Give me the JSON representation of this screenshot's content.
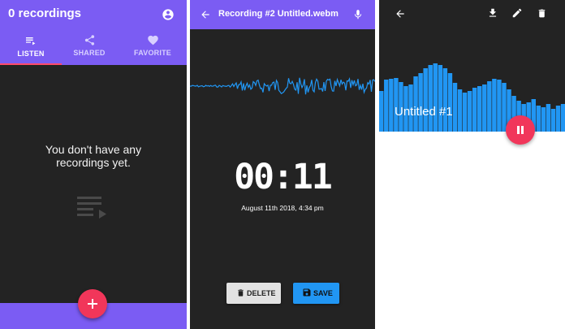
{
  "colors": {
    "primary": "#7b5cf3",
    "accent": "#f1365a",
    "dark_background": "#232323",
    "waveform": "#2196f3",
    "save_button": "#2196f3",
    "delete_button": "#e2e2e2"
  },
  "list_screen": {
    "title": "0 recordings",
    "account_icon": "account-circle-icon",
    "tabs": [
      {
        "label": "LISTEN",
        "icon": "playlist-icon",
        "active": true
      },
      {
        "label": "SHARED",
        "icon": "share-icon",
        "active": false
      },
      {
        "label": "FAVORITE",
        "icon": "heart-icon",
        "active": false
      }
    ],
    "empty_message": "You don't have any recordings yet.",
    "empty_icon": "playlist-play-icon",
    "fab_icon": "plus-icon"
  },
  "recording_screen": {
    "title": "Recording #2 Untitled.webm",
    "back_icon": "arrow-back-icon",
    "mic_icon": "microphone-icon",
    "timer": "00:11",
    "date": "August 11th 2018, 4:34 pm",
    "delete_label": "DELETE",
    "save_label": "SAVE"
  },
  "playback_screen": {
    "title": "Untitled #1",
    "icons": [
      "arrow-back-icon",
      "download-icon",
      "edit-icon",
      "trash-icon"
    ],
    "fab_icon": "pause-icon"
  }
}
